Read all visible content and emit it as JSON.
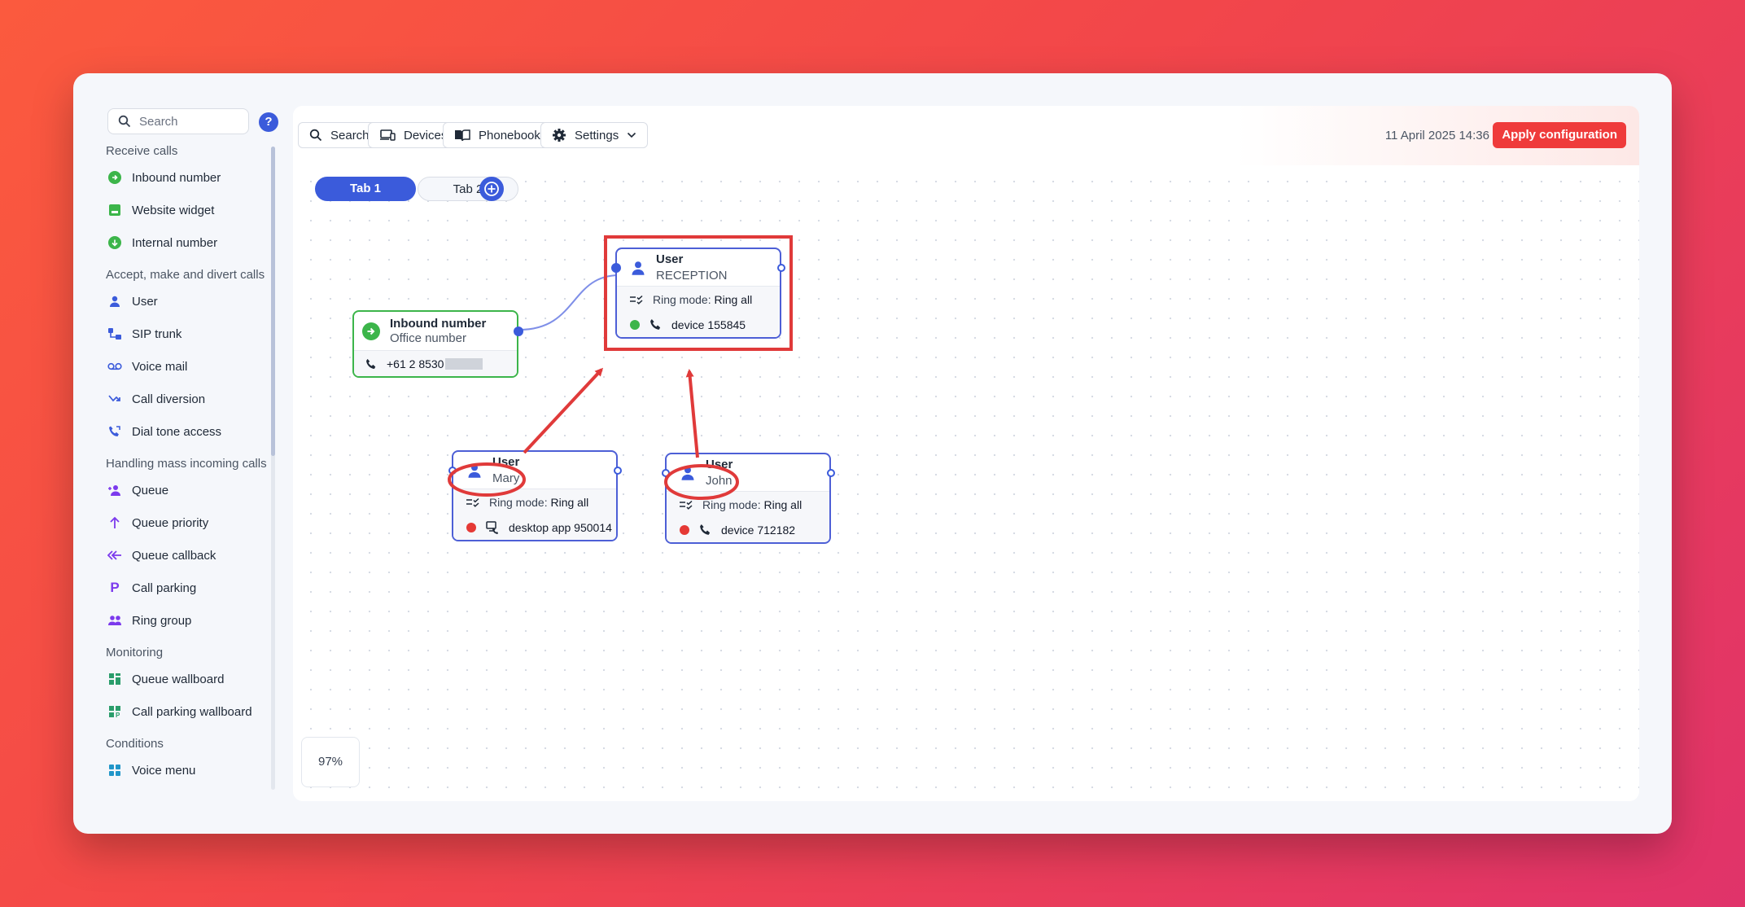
{
  "sidebar": {
    "search_placeholder": "Search",
    "help_label": "?",
    "sections": [
      {
        "title": "Receive calls",
        "items": [
          {
            "label": "Inbound number",
            "icon": "inbound-arrow-icon"
          },
          {
            "label": "Website widget",
            "icon": "widget-icon"
          },
          {
            "label": "Internal number",
            "icon": "internal-number-icon"
          }
        ]
      },
      {
        "title": "Accept, make and divert calls",
        "items": [
          {
            "label": "User",
            "icon": "user-icon"
          },
          {
            "label": "SIP trunk",
            "icon": "sip-trunk-icon"
          },
          {
            "label": "Voice mail",
            "icon": "voicemail-icon"
          },
          {
            "label": "Call diversion",
            "icon": "call-diversion-icon"
          },
          {
            "label": "Dial tone access",
            "icon": "dial-tone-icon"
          }
        ]
      },
      {
        "title": "Handling mass incoming calls",
        "items": [
          {
            "label": "Queue",
            "icon": "queue-icon"
          },
          {
            "label": "Queue priority",
            "icon": "arrow-up-icon"
          },
          {
            "label": "Queue callback",
            "icon": "callback-icon"
          },
          {
            "label": "Call parking",
            "icon": "parking-icon"
          },
          {
            "label": "Ring group",
            "icon": "ring-group-icon"
          }
        ]
      },
      {
        "title": "Monitoring",
        "items": [
          {
            "label": "Queue wallboard",
            "icon": "wallboard-icon"
          },
          {
            "label": "Call parking wallboard",
            "icon": "parking-wallboard-icon"
          }
        ]
      },
      {
        "title": "Conditions",
        "items": [
          {
            "label": "Voice menu",
            "icon": "voice-menu-icon"
          }
        ]
      }
    ]
  },
  "toolbar": {
    "search_label": "Search",
    "devices_label": "Devices",
    "phonebooks_label": "Phonebooks",
    "settings_label": "Settings",
    "datetime": "11 April 2025 14:36",
    "apply_label": "Apply configuration"
  },
  "tabs": {
    "tab1": "Tab 1",
    "tab2": "Tab 2"
  },
  "zoom": "97%",
  "nodes": {
    "inbound": {
      "title": "Inbound number",
      "subtitle": "Office number",
      "number": "+61 2 8530"
    },
    "reception": {
      "title": "User",
      "subtitle": "RECEPTION",
      "ring_prefix": "Ring mode:",
      "ring_value": "Ring all",
      "device": "device 155845",
      "status_color": "#3cb54a"
    },
    "mary": {
      "title": "User",
      "subtitle": "Mary",
      "ring_prefix": "Ring mode:",
      "ring_value": "Ring all",
      "device": "desktop app 950014",
      "status_color": "#e53935"
    },
    "john": {
      "title": "User",
      "subtitle": "John",
      "ring_prefix": "Ring mode:",
      "ring_value": "Ring all",
      "device": "device 712182",
      "status_color": "#e53935"
    }
  },
  "colors": {
    "accent": "#3b5bdb",
    "apply": "#ef3b3b",
    "annotation": "#e03a3a",
    "inbound_border": "#3cb54a"
  }
}
